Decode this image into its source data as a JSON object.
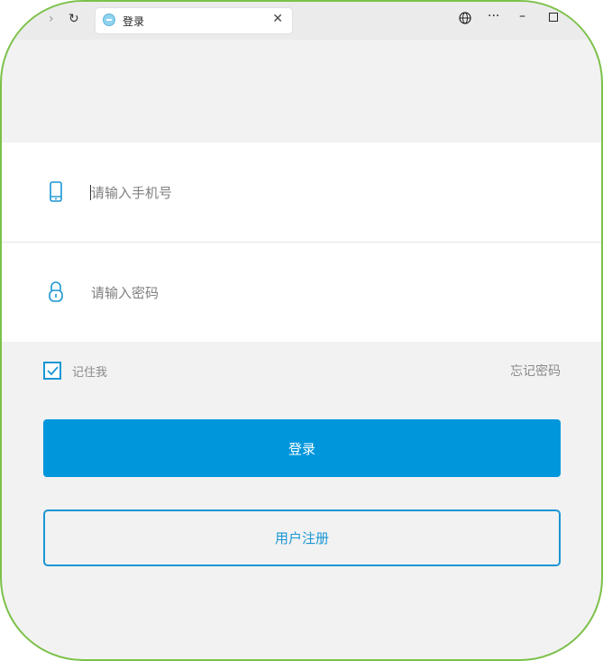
{
  "browser": {
    "tab_title": "登录",
    "icons": {
      "forward": "chevron-right-icon",
      "refresh": "refresh-icon",
      "close": "close-icon",
      "globe": "globe-icon",
      "more": "more-icon",
      "minimize": "minimize-icon",
      "maximize": "maximize-icon"
    }
  },
  "login": {
    "phone_placeholder": "请输入手机号",
    "password_placeholder": "请输入密码",
    "remember_label": "记住我",
    "remember_checked": true,
    "forgot_label": "忘记密码",
    "login_button": "登录",
    "register_button": "用户注册"
  },
  "colors": {
    "accent": "#0096dc",
    "frame_border": "#7cc14a",
    "background": "#f2f2f2"
  }
}
